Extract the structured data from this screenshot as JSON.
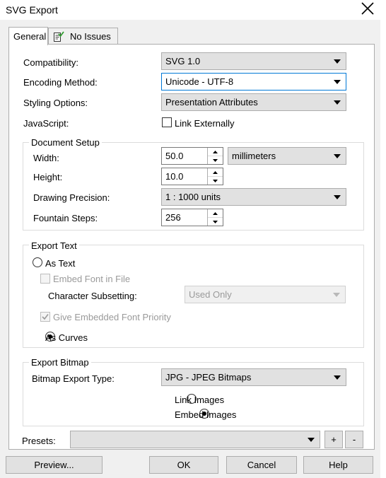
{
  "window": {
    "title": "SVG Export",
    "close_glyph": "close-icon"
  },
  "tabs": [
    {
      "label": "General",
      "active": true
    },
    {
      "label": "No Issues",
      "icon": "report-check-icon"
    }
  ],
  "general": {
    "compatibility": {
      "label": "Compatibility:",
      "value": "SVG 1.0"
    },
    "encoding": {
      "label": "Encoding Method:",
      "value": "Unicode - UTF-8"
    },
    "styling": {
      "label": "Styling Options:",
      "value": "Presentation Attributes"
    },
    "javascript": {
      "label": "JavaScript:",
      "checkbox_label": "Link Externally",
      "checked": false
    }
  },
  "document_setup": {
    "title": "Document Setup",
    "width": {
      "label": "Width:",
      "value": "50.0"
    },
    "units": {
      "value": "millimeters"
    },
    "height": {
      "label": "Height:",
      "value": "10.0"
    },
    "precision": {
      "label": "Drawing Precision:",
      "value": "1 : 1000 units"
    },
    "fountain": {
      "label": "Fountain Steps:",
      "value": "256"
    }
  },
  "export_text": {
    "title": "Export Text",
    "as_text": {
      "label": "As Text",
      "selected": false
    },
    "embed_font": {
      "label": "Embed Font in File",
      "checked": false,
      "enabled": false
    },
    "subsetting": {
      "label": "Character Subsetting:",
      "value": "Used Only",
      "enabled": false
    },
    "give_priority": {
      "label": "Give Embedded Font Priority",
      "checked": true,
      "enabled": false
    },
    "as_curves": {
      "label": "As Curves",
      "selected": true
    }
  },
  "export_bitmap": {
    "title": "Export Bitmap",
    "type": {
      "label": "Bitmap Export Type:",
      "value": "JPG - JPEG Bitmaps"
    },
    "link_images": {
      "label": "Link Images",
      "selected": false
    },
    "embed_images": {
      "label": "Embed Images",
      "selected": true
    }
  },
  "presets": {
    "label": "Presets:",
    "value": "",
    "add": "+",
    "remove": "-"
  },
  "buttons": {
    "preview": "Preview...",
    "ok": "OK",
    "cancel": "Cancel",
    "help": "Help"
  }
}
